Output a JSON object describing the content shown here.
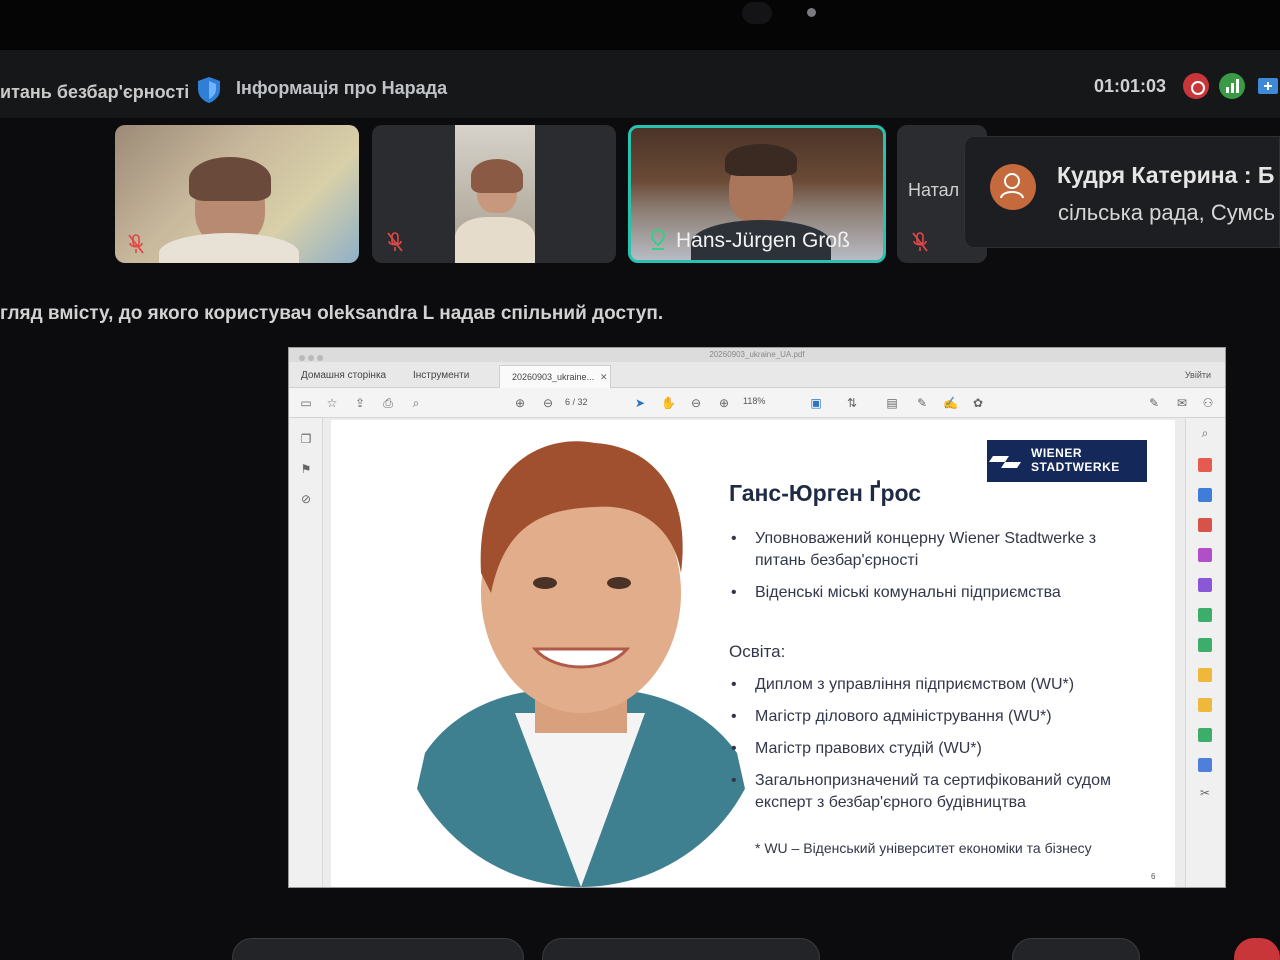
{
  "meeting": {
    "title_partial": "итань безбар'єрності",
    "info_link": "Інформація про Нарада",
    "timer": "01:01:03"
  },
  "participants": [
    {
      "name": "",
      "muted": true
    },
    {
      "name": "",
      "muted": true
    },
    {
      "name": "Hans-Jürgen Groß",
      "muted": false,
      "active_speaker": true
    },
    {
      "name": "Натал",
      "muted": true
    }
  ],
  "notification": {
    "name": "Кудря Катерина : Б",
    "subtitle": "сільська рада, Сумсь"
  },
  "share_caption": "гляд вмісту, до якого користувач oleksandra L надав спільний доступ.",
  "pdf": {
    "window_title": "20260903_ukraine_UA.pdf",
    "tabs": {
      "home": "Домашня сторінка",
      "tools": "Інструменти",
      "document": "20260903_ukraine...",
      "signin": "Увійти"
    },
    "page_current": "6",
    "page_total": "/ 32",
    "zoom": "118%"
  },
  "slide": {
    "logo_line1": "WIENER",
    "logo_line2": "STADTWERKE",
    "name": "Ганс-Юрген Ґрос",
    "roles": [
      "Уповноважений концерну Wiener Stadtwerke з питань безбар'єрності",
      "Віденські міські комунальні підприємства"
    ],
    "education_label": "Освіта:",
    "education": [
      "Диплом з управління підприємством (WU*)",
      "Магістр ділового адміністрування (WU*)",
      "Магістр правових студій (WU*)",
      "Загальнопризначений та сертифікований судом експерт з безбар'єрного будівництва"
    ],
    "footnote": "* WU – Віденський університет економіки та бізнесу",
    "page_number": "6"
  },
  "colors": {
    "background": "#0c0c0e",
    "active_border": "#29c2b0",
    "record": "#c8363a",
    "signal": "#3a9a45",
    "logo_bg": "#14285a",
    "avatar": "#c46a3c"
  }
}
